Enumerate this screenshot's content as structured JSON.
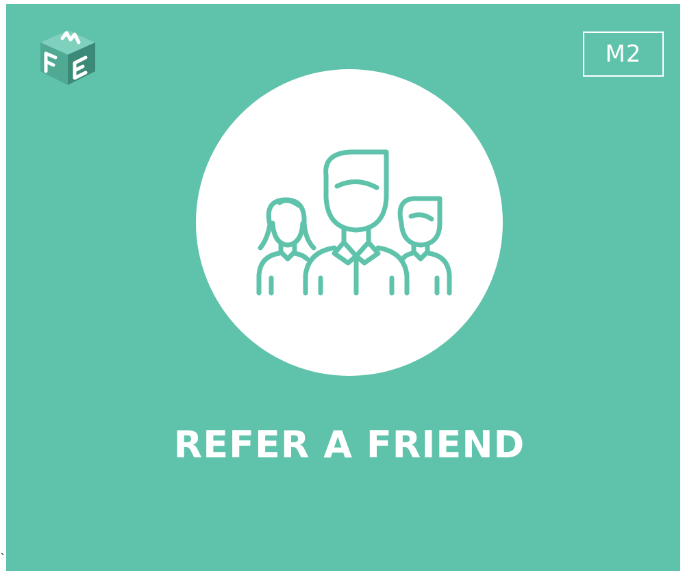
{
  "colors": {
    "background": "#5fc2aa",
    "foreground": "#ffffff",
    "logo_dark": "#3d8f7c",
    "logo_light": "#d8efe8"
  },
  "logo": {
    "letters": "FME",
    "icon": "fme-cube-logo"
  },
  "badge": {
    "label": "M2"
  },
  "hero": {
    "icon": "group-of-people-icon",
    "title": "REFER A FRIEND"
  },
  "stray_mark": "`"
}
